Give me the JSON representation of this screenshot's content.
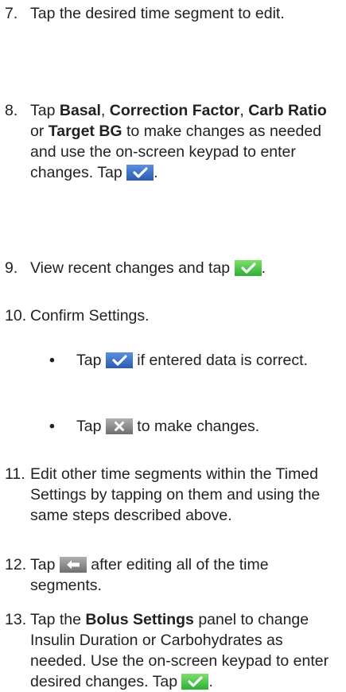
{
  "steps": [
    {
      "num": "7.",
      "text": "Tap the desired time segment to edit."
    },
    {
      "num": "8.",
      "prefix": "Tap ",
      "kw1": "Basal",
      "sep1": ", ",
      "kw2": "Correction Factor",
      "sep2": ", ",
      "kw3": "Carb Ratio",
      "sep3": " or ",
      "kw4": "Target BG",
      "suffix": " to make changes as needed and use the on-screen keypad to enter changes.",
      "tap": "Tap",
      "end": "."
    },
    {
      "num": "9.",
      "text": "View recent changes and tap",
      "end": "."
    },
    {
      "num": "10.",
      "text": "Confirm Settings."
    },
    {
      "num": "11.",
      "text": "Edit other time segments within the Timed Settings by tapping on them and using the same steps described above."
    },
    {
      "num": "12.",
      "tap": "Tap",
      "text": "after editing all of the time segments."
    },
    {
      "num": "13.",
      "prefix": "Tap the ",
      "kw": "Bolus Settings",
      "suffix": " panel to change Insulin Duration or Carbohydrates as needed. Use the on-screen keypad to enter desired changes.",
      "tap": "Tap",
      "end": "."
    }
  ],
  "bullets": [
    {
      "dot": "•",
      "tap": "Tap",
      "text": "if entered data is correct."
    },
    {
      "dot": "•",
      "tap": "Tap",
      "text": "to make changes."
    }
  ],
  "icons": {
    "check_blue": "#3a6fc4",
    "check_green": "#3cc444",
    "cancel_gray": "#8c8c8c",
    "back_gray": "#8c8c8c"
  }
}
